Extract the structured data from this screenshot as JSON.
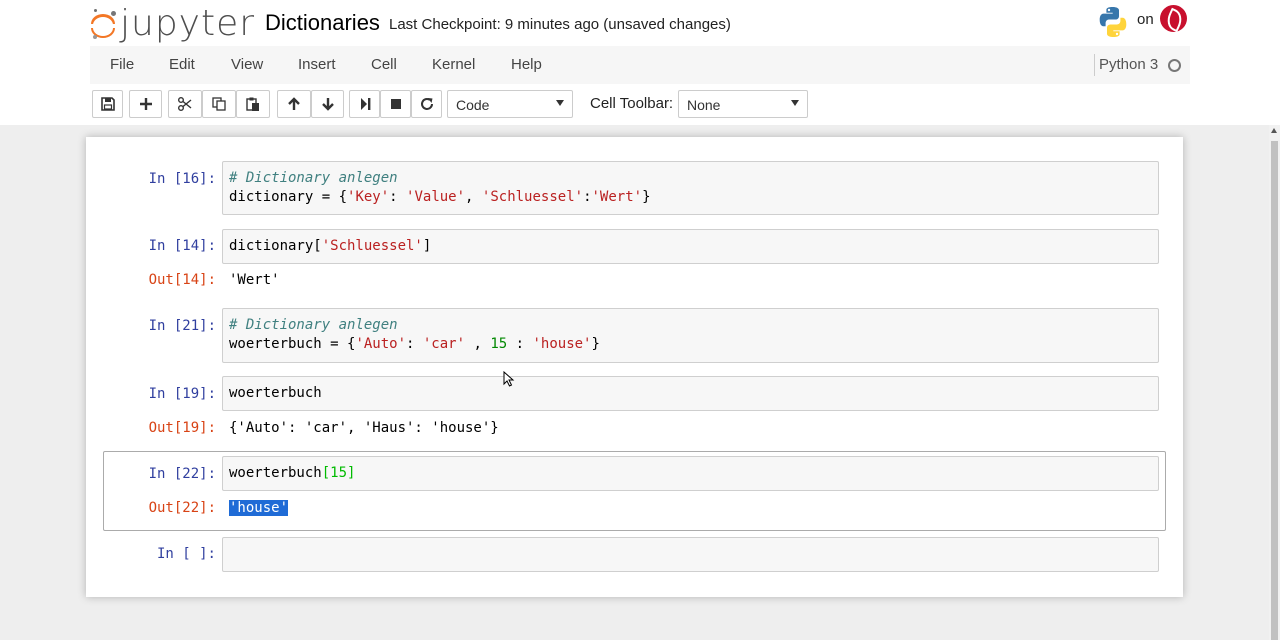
{
  "header": {
    "logo_text": "jupyter",
    "notebook_name": "Dictionaries",
    "checkpoint": "Last Checkpoint: 9 minutes ago (unsaved changes)",
    "on_label": "on"
  },
  "menu": {
    "items": [
      "File",
      "Edit",
      "View",
      "Insert",
      "Cell",
      "Kernel",
      "Help"
    ],
    "kernel_name": "Python 3"
  },
  "toolbar": {
    "buttons": [
      "save-icon",
      "plus-icon",
      "cut-icon",
      "copy-icon",
      "paste-icon",
      "arrow-up-icon",
      "arrow-down-icon",
      "step-forward-icon",
      "stop-icon",
      "refresh-icon"
    ],
    "cell_type": "Code",
    "cell_toolbar_label": "Cell Toolbar:",
    "cell_toolbar_value": "None"
  },
  "cells": [
    {
      "in_prompt": "In [16]:",
      "line1": "# Dictionary anlegen",
      "line2": {
        "a": "dictionary = {",
        "b": "'Key'",
        "c": ": ",
        "d": "'Value'",
        "e": ", ",
        "f": "'Schluessel'",
        "g": ":",
        "h": "'Wert'",
        "i": "}"
      }
    },
    {
      "in_prompt": "In [14]:",
      "code": {
        "a": "dictionary[",
        "b": "'Schluessel'",
        "c": "]"
      },
      "out_prompt": "Out[14]:",
      "output": "'Wert'"
    },
    {
      "in_prompt": "In [21]:",
      "line1": "# Dictionary anlegen",
      "line2": {
        "a": "woerterbuch = {",
        "b": "'Auto'",
        "c": ": ",
        "d": "'car'",
        "e": " , ",
        "f": "15",
        "g": " : ",
        "h": "'house'",
        "i": "}"
      }
    },
    {
      "in_prompt": "In [19]:",
      "code": "woerterbuch",
      "out_prompt": "Out[19]:",
      "output": "{'Auto': 'car', 'Haus': 'house'}"
    },
    {
      "in_prompt": "In [22]:",
      "code": {
        "a": "woerterbuch",
        "b": "[15]"
      },
      "out_prompt": "Out[22]:",
      "output": "'house'"
    },
    {
      "in_prompt": "In [ ]:"
    }
  ],
  "colors": {
    "logo_orange": "#F37726",
    "in_prompt": "#303F9F",
    "out_prompt": "#D84315",
    "selection": "#1f6bd6"
  }
}
